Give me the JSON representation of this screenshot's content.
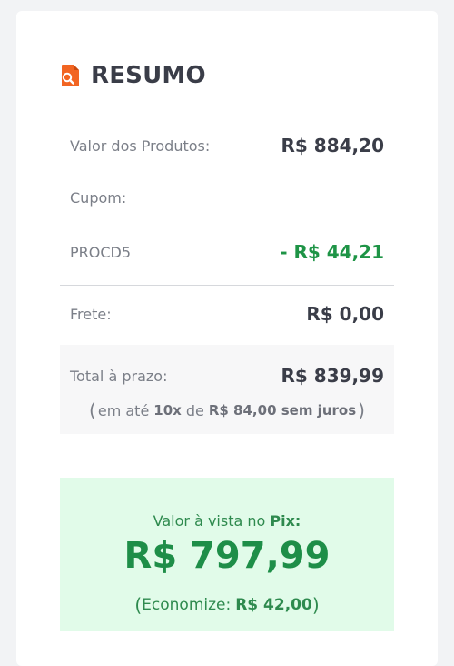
{
  "summary": {
    "title": "RESUMO",
    "icon": "document-search-icon",
    "accent_color": "#f26522"
  },
  "rows": {
    "products_label": "Valor dos Produtos:",
    "products_value": "R$ 884,20",
    "coupon_label": "Cupom:",
    "coupon_code": "PROCD5",
    "coupon_discount": "- R$ 44,21",
    "shipping_label": "Frete:",
    "shipping_value": "R$ 0,00"
  },
  "total": {
    "label": "Total à prazo:",
    "value": "R$ 839,99",
    "installments_prefix": "em até",
    "installments_count": "10x",
    "installments_mid": "de",
    "installments_amount": "R$ 84,00 sem juros"
  },
  "pix": {
    "label_prefix": "Valor à vista no",
    "label_method": "Pix:",
    "price": "R$ 797,99",
    "savings_label": "Economize:",
    "savings_value": "R$ 42,00",
    "color": "#1e8e48",
    "background": "#e1fbe9"
  }
}
